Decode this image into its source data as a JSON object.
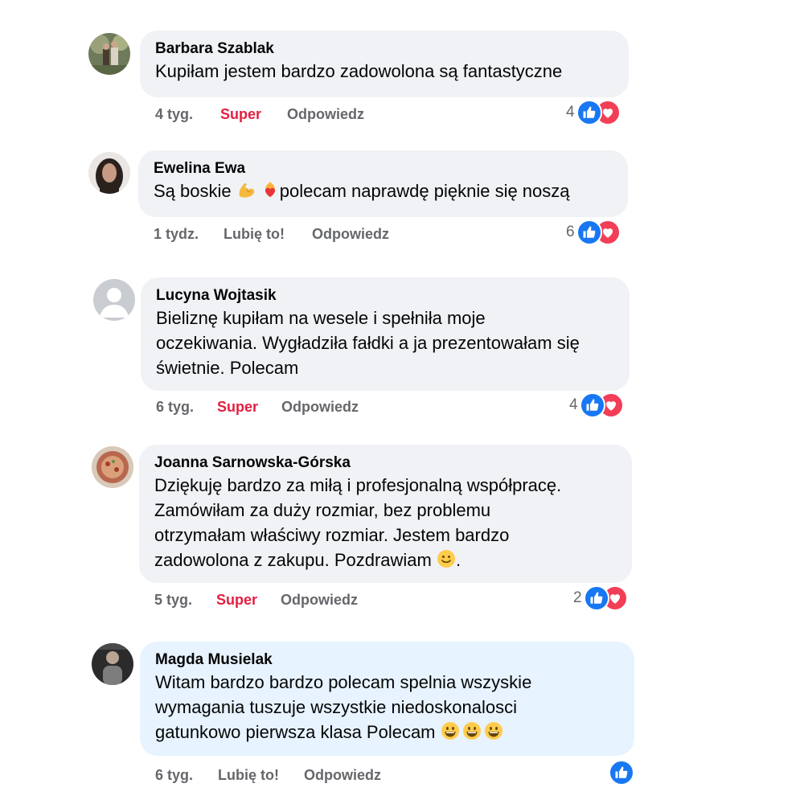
{
  "comments": [
    {
      "author": "Barbara Szablak",
      "text": "Kupiłam jestem bardzo zadowolona są fantastyczne",
      "time": "4 tyg.",
      "reaction_label": "Super",
      "reply_label": "Odpowiedz",
      "reaction_count": "4"
    },
    {
      "author": "Ewelina Ewa",
      "text_before": "Są boskie ",
      "text_after": "polecam naprawdę pięknie się noszą",
      "time": "1 tydz.",
      "reaction_label": "Lubię to!",
      "reply_label": "Odpowiedz",
      "reaction_count": "6"
    },
    {
      "author": "Lucyna Wojtasik",
      "lines": [
        "Bieliznę kupiłam na wesele i spełniła moje",
        "oczekiwania. Wygładziła fałdki a ja prezentowałam się",
        "świetnie. Polecam"
      ],
      "time": "6 tyg.",
      "reaction_label": "Super",
      "reply_label": "Odpowiedz",
      "reaction_count": "4"
    },
    {
      "author": "Joanna Sarnowska-Górska",
      "lines": [
        "Dziękuję bardzo za miłą i profesjonalną współpracę.",
        "Zamówiłam za duży rozmiar, bez problemu",
        "otrzymałam właściwy rozmiar. Jestem bardzo",
        "zadowolona z zakupu. Pozdrawiam "
      ],
      "line_end": ".",
      "time": "5 tyg.",
      "reaction_label": "Super",
      "reply_label": "Odpowiedz",
      "reaction_count": "2"
    },
    {
      "author": "Magda Musielak",
      "lines": [
        "Witam bardzo bardzo polecam spelnia wszyskie",
        "wymagania tuszuje wszystkie niedoskonalosci",
        "gatunkowo pierwsza klasa Polecam "
      ],
      "time": "6 tyg.",
      "reaction_label": "Lubię to!",
      "reply_label": "Odpowiedz"
    }
  ],
  "icons": {
    "like": "thumbs-up-icon",
    "love": "heart-icon",
    "flexed_biceps": "flexed-biceps-emoji",
    "heart_on_fire": "heart-on-fire-emoji",
    "smile": "smiling-face-emoji",
    "grin": "grinning-face-emoji"
  },
  "colors": {
    "bubble": "#f0f2f5",
    "bubble_highlight": "#e7f3ff",
    "like_blue": "#1877f2",
    "love_red": "#f33e58",
    "super_red": "#e41e3f",
    "secondary_text": "#65676b"
  }
}
